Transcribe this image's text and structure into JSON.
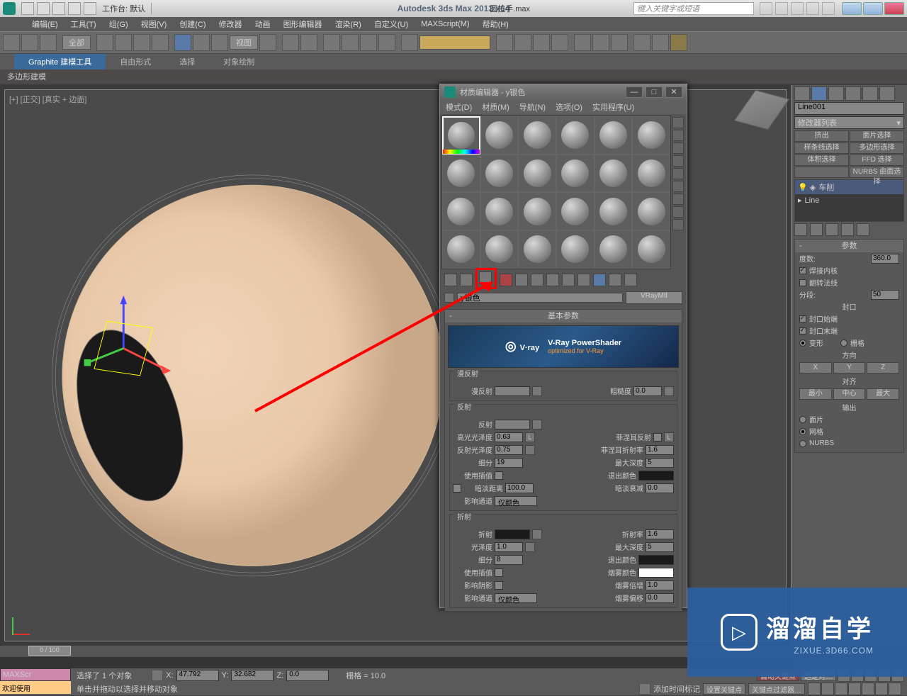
{
  "titlebar": {
    "workspace_label": "工作台: 默认",
    "app_title": "Autodesk 3ds Max  2013 x64",
    "file_name": "圆拉手.max",
    "search_placeholder": "键入关键字或短语"
  },
  "menus": [
    "编辑(E)",
    "工具(T)",
    "组(G)",
    "视图(V)",
    "创建(C)",
    "修改器",
    "动画",
    "图形编辑器",
    "渲染(R)",
    "自定义(U)",
    "MAXScript(M)",
    "帮助(H)"
  ],
  "toolbar": {
    "all_filter": "全部",
    "view_combo": "视图"
  },
  "ribbon": {
    "tabs": [
      "Graphite 建模工具",
      "自由形式",
      "选择",
      "对象绘制"
    ],
    "subpanel": "多边形建模"
  },
  "viewport": {
    "label": "[+] [正交] [真实 + 边面]"
  },
  "material_editor": {
    "title": "材质编辑器 - y银色",
    "menus": [
      "模式(D)",
      "材质(M)",
      "导航(N)",
      "选项(O)",
      "实用程序(U)"
    ],
    "name_value": "y银色",
    "type": "VRayMtl",
    "rollup_basic": "基本参数",
    "banner_main": "V-Ray PowerShader",
    "banner_sub": "optimized for V-Ray",
    "banner_logo": "V·ray",
    "groups": {
      "diffuse": {
        "label": "漫反射",
        "diffuse_lbl": "漫反射",
        "rough_lbl": "粗糙度",
        "rough_val": "0.0"
      },
      "reflect": {
        "label": "反射",
        "reflect_lbl": "反射",
        "hilight_lbl": "高光光泽度",
        "hilight_val": "0.63",
        "l_btn": "L",
        "refl_gloss_lbl": "反射光泽度",
        "refl_gloss_val": "0.75",
        "fresnel_lbl": "菲涅耳反射",
        "ior_lbl": "菲涅耳折射率",
        "ior_val": "1.6",
        "subdiv_lbl": "细分",
        "subdiv_val": "19",
        "maxdepth_lbl": "最大深度",
        "maxdepth_val": "5",
        "interp_lbl": "使用插值",
        "exit_lbl": "退出颜色",
        "dim_dist_lbl": "暗淡距离",
        "dim_dist_val": "100.0",
        "dim_fall_lbl": "暗淡衰减",
        "dim_fall_val": "0.0",
        "affect_lbl": "影响通道",
        "affect_val": "仅颜色"
      },
      "refract": {
        "label": "折射",
        "refract_lbl": "折射",
        "ior_lbl": "折射率",
        "ior_val": "1.6",
        "gloss_lbl": "光泽度",
        "gloss_val": "1.0",
        "maxdepth_lbl": "最大深度",
        "maxdepth_val": "5",
        "subdiv_lbl": "细分",
        "subdiv_val": "8",
        "exit_lbl": "退出颜色",
        "interp_lbl": "使用插值",
        "fog_lbl": "烟雾颜色",
        "shadow_lbl": "影响阴影",
        "fog_mult_lbl": "烟雾倍增",
        "fog_mult_val": "1.0",
        "affect_lbl": "影响通道",
        "affect_val": "仅颜色",
        "fog_bias_lbl": "烟雾偏移",
        "fog_bias_val": "0.0"
      }
    }
  },
  "command_panel": {
    "obj_name": "Line001",
    "modifier_combo": "修改器列表",
    "mod_buttons": [
      "挤出",
      "面片选择",
      "样条线选择",
      "多边形选择",
      "体积选择",
      "FFD 选择",
      "",
      "NURBS 曲面选择"
    ],
    "stack": [
      "车削",
      "Line"
    ],
    "rollup_params": "参数",
    "params": {
      "degree_lbl": "度数:",
      "degree_val": "360.0",
      "weld_lbl": "焊接内核",
      "flip_lbl": "翻转法线",
      "seg_lbl": "分段:",
      "seg_val": "50",
      "cap_lbl": "封口",
      "cap_start": "封口始端",
      "cap_end": "封口末端",
      "morph": "变形",
      "grid": "栅格",
      "dir_lbl": "方向",
      "x": "X",
      "y": "Y",
      "z": "Z",
      "align_lbl": "对齐",
      "min": "最小",
      "center": "中心",
      "max": "最大",
      "output_lbl": "输出",
      "patch": "面片",
      "mesh": "网格",
      "nurbs": "NURBS"
    }
  },
  "timeline": {
    "handle": "0 / 100"
  },
  "status": {
    "welcome": "欢迎使用",
    "maxscr": "MAXScr",
    "msg1": "选择了 1 个对象",
    "msg2": "单击并拖动以选择并移动对象",
    "x": "47.792",
    "y": "32.682",
    "z": "0.0",
    "grid": "栅格 = 10.0",
    "autokey": "自动关键点",
    "selset": "选定对…",
    "setkey": "设置关键点",
    "keyfilter": "关键点过滤器…",
    "add_time": "添加时间标记"
  },
  "watermark": {
    "text": "溜溜自学",
    "sub": "ZIXUE.3D66.COM"
  }
}
